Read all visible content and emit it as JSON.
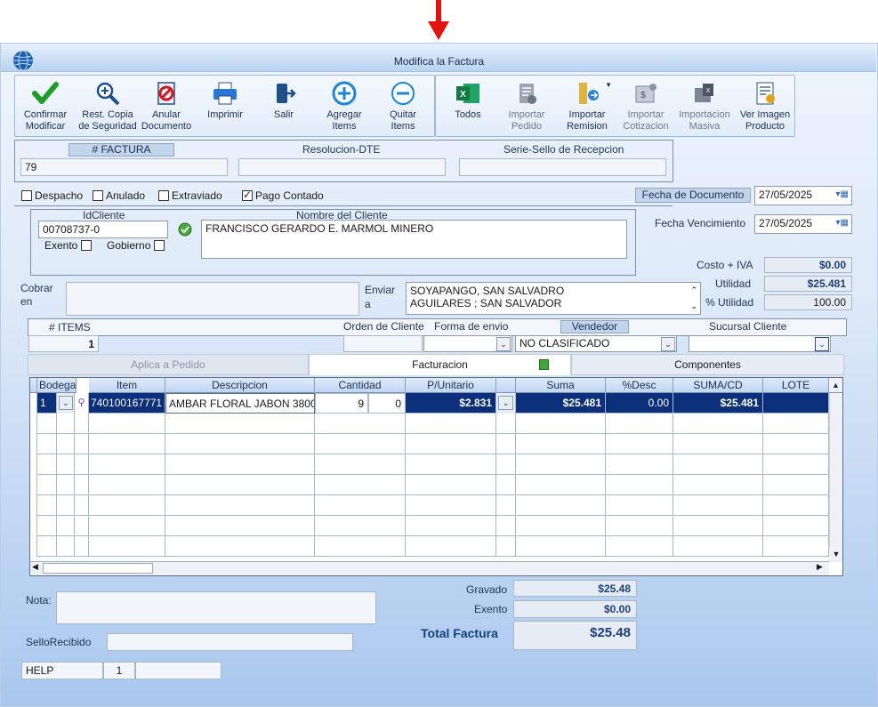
{
  "window": {
    "title": "Modifica la Factura"
  },
  "toolbar": {
    "confirm": [
      "Confirmar",
      "Modificar"
    ],
    "backup": [
      "Rest. Copia",
      "de Seguridad"
    ],
    "cancel": [
      "Anular",
      "Documento"
    ],
    "print": [
      "Imprimir",
      ""
    ],
    "exit": [
      "Salir",
      ""
    ],
    "add": [
      "Agregar",
      "Items"
    ],
    "remove": [
      "Quitar",
      "Items"
    ],
    "all": [
      "Todos",
      ""
    ],
    "import_order": [
      "Importar",
      "Pedido"
    ],
    "import_remission": [
      "Importar",
      "Remision"
    ],
    "import_quote": [
      "Importar",
      "Cotizacion"
    ],
    "import_bulk": [
      "Importacion",
      "Masiva"
    ],
    "view_image": [
      "Ver Imagen",
      "Producto"
    ]
  },
  "invoice": {
    "number_label": "# FACTURA",
    "number": "79",
    "resolution_label": "Resolucion-DTE",
    "resolution": "",
    "serial_label": "Serie-Sello de Recepcion",
    "serial": ""
  },
  "flags": {
    "despacho": "Despacho",
    "anulado": "Anulado",
    "extraviado": "Extraviado",
    "pago": "Pago Contado"
  },
  "dates": {
    "doc_label": "Fecha de  Documento",
    "doc": "27/05/2025",
    "due_label": "Fecha Vencimiento",
    "due": "27/05/2025"
  },
  "client": {
    "id_label": "IdCliente",
    "id": "00708737-0",
    "name_label": "Nombre del Cliente",
    "name": "FRANCISCO GERARDO E. MARMOL MINERO",
    "exento": "Exento",
    "gobierno": "Gobierno"
  },
  "summary": {
    "cost_label": "Costo + IVA",
    "cost": "$0.00",
    "util_label": "Utilidad",
    "util": "$25.481",
    "pct_label": "% Utilidad",
    "pct": "100.00"
  },
  "cobrar": {
    "label1": "Cobrar",
    "label2": "en",
    "value": ""
  },
  "enviar": {
    "label1": "Enviar",
    "label2": "a",
    "line1": "SOYAPANGO, SAN SALVADRO",
    "line2": "AGUILARES ; SAN SALVADOR"
  },
  "items": {
    "count_label": "# ITEMS",
    "count": "1",
    "order_label": "Orden de Cliente",
    "ship_label": "Forma de envio",
    "seller_label": "Vendedor",
    "seller": "NO CLASIFICADO",
    "branch_label": "Sucursal Cliente"
  },
  "tabs": {
    "pedido": "Aplica a Pedido",
    "facturacion": "Facturacion",
    "componentes": "Componentes"
  },
  "grid": {
    "headers": [
      "Bodega",
      "Item",
      "Descripcion",
      "Cantidad",
      "P/Unitario",
      "Suma",
      "%Desc",
      "SUMA/CD",
      "LOTE"
    ],
    "row": {
      "bodega": "1",
      "item": "740100167771",
      "desc": "AMBAR FLORAL JABON 3800",
      "qty": "9",
      "qty2": "0",
      "price": "$2.831",
      "suma": "$25.481",
      "desc_pct": "0.00",
      "sumacd": "$25.481",
      "lote": ""
    }
  },
  "notes": {
    "nota_label": "Nota:",
    "sello_label": "SelloRecibido"
  },
  "totals": {
    "gravado_label": "Gravado",
    "gravado": "$25.48",
    "exento_label": "Exento",
    "exento": "$0.00",
    "total_label": "Total Factura",
    "total": "$25.48"
  },
  "status": {
    "help": "HELP",
    "page": "1",
    "extra": ""
  },
  "colors": {
    "accent": "#0b2f7a",
    "arrow": "#e3120b"
  }
}
